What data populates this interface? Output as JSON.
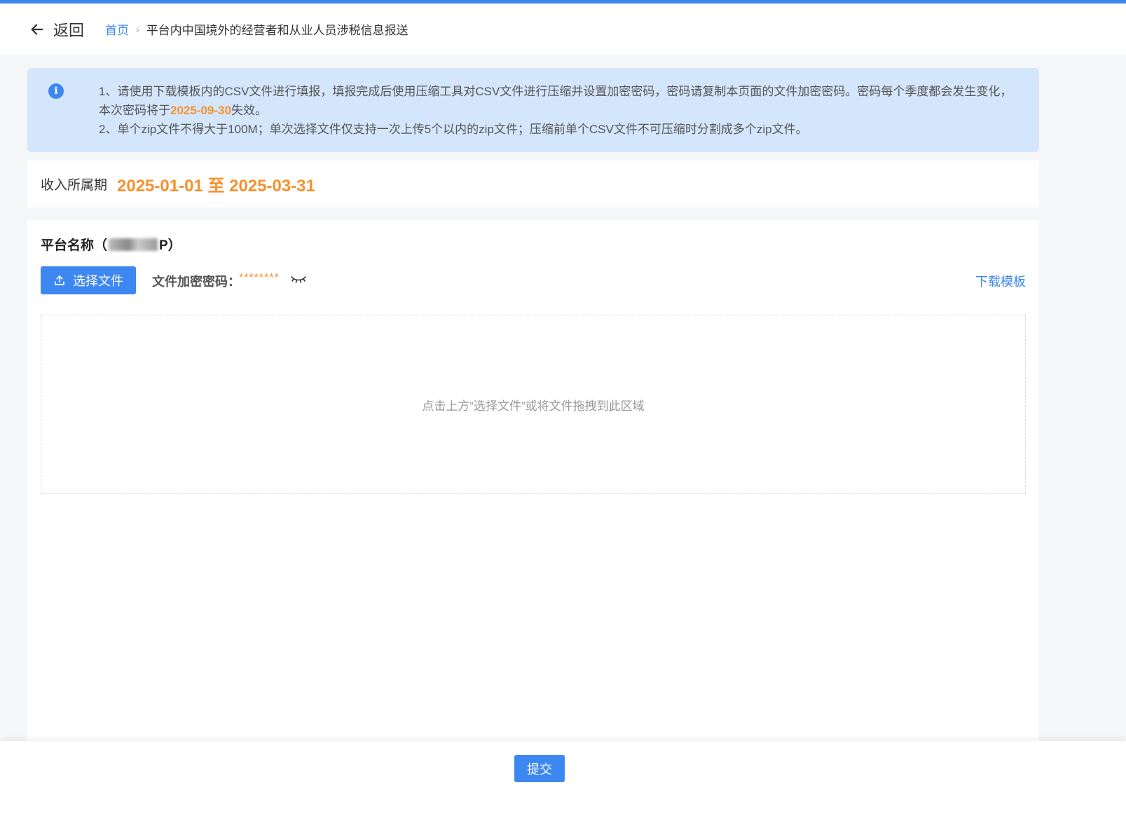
{
  "header": {
    "back_label": "返回",
    "breadcrumb": {
      "home": "首页",
      "separator": "›",
      "current": "平台内中国境外的经营者和从业人员涉税信息报送"
    }
  },
  "notice": {
    "line1_prefix": "1、请使用下载模板内的CSV文件进行填报，填报完成后使用压缩工具对CSV文件进行压缩并设置加密密码，密码请复制本页面的文件加密密码。密码每个季度都会发生变化，本次密码将于",
    "line1_date": "2025-09-30",
    "line1_suffix": "失效。",
    "line2": "2、单个zip文件不得大于100M；单次选择文件仅支持一次上传5个以内的zip文件；压缩前单个CSV文件不可压缩时分割成多个zip文件。",
    "icon": "info-icon"
  },
  "period": {
    "label": "收入所属期",
    "value": "2025-01-01 至 2025-03-31"
  },
  "card": {
    "platform_prefix": "平台名称（",
    "platform_suffix": "P）",
    "upload_label": "选择文件",
    "password_label": "文件加密密码：",
    "password_value": "********",
    "download_label": "下载模板",
    "dropzone_text": "点击上方“选择文件”或将文件拖拽到此区域"
  },
  "footer": {
    "submit_label": "提交"
  },
  "colors": {
    "primary": "#3d87f0",
    "highlight": "#f5912e",
    "notice_bg": "#d4e6fc"
  }
}
